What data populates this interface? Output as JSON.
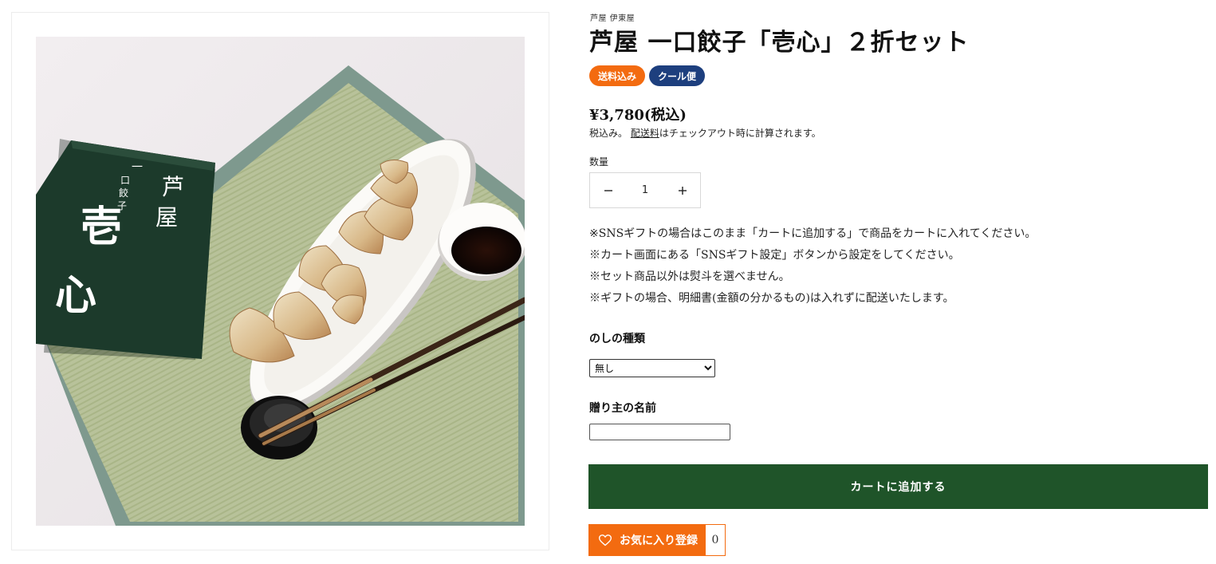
{
  "product": {
    "vendor": "芦屋 伊東屋",
    "title": "芦屋 一口餃子「壱心」２折セット",
    "badges": [
      {
        "label": "送料込み",
        "color": "#f36b10"
      },
      {
        "label": "クール便",
        "color": "#1d3f7e"
      }
    ],
    "price": "¥3,780(税込)",
    "tax_note_prefix": "税込み。",
    "tax_note_link": "配送料",
    "tax_note_suffix": "はチェックアウト時に計算されます。",
    "image_packaging_text": {
      "brand_line": "一口餃子",
      "place": "芦屋",
      "name": "壱心"
    }
  },
  "quantity": {
    "label": "数量",
    "value": "1",
    "decrease_icon": "minus-icon",
    "increase_icon": "plus-icon"
  },
  "notes": [
    "※SNSギフトの場合はこのまま「カートに追加する」で商品をカートに入れてください。",
    "※カート画面にある「SNSギフト設定」ボタンから設定をしてください。",
    "※セット商品以外は熨斗を選べません。",
    "※ギフトの場合、明細書(金額の分かるもの)は入れずに配送いたします。"
  ],
  "noshi": {
    "label": "のしの種類",
    "selected": "無し"
  },
  "sender": {
    "label": "贈り主の名前",
    "value": ""
  },
  "cart_button": {
    "label": "カートに追加する",
    "color": "#1f5429"
  },
  "favorite": {
    "icon": "heart-icon",
    "label": "お気に入り登録",
    "count": "0",
    "color": "#f36b10"
  }
}
